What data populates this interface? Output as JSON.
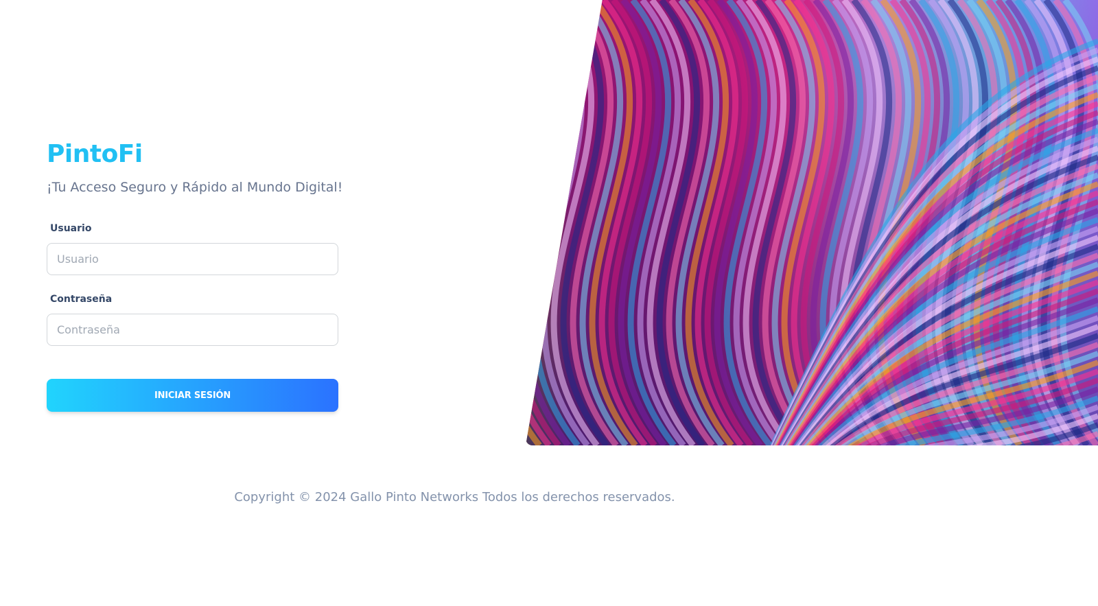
{
  "brand": {
    "name": "PintoFi",
    "tagline": "¡Tu Acceso Seguro y Rápido al Mundo Digital!"
  },
  "login_form": {
    "username": {
      "label": "Usuario",
      "placeholder": "Usuario",
      "value": ""
    },
    "password": {
      "label": "Contraseña",
      "placeholder": "Contraseña",
      "value": ""
    },
    "submit_label": "INICIAR SESIÓN"
  },
  "footer": {
    "copyright": "Copyright © 2024 Gallo Pinto Networks Todos los derechos reservados."
  },
  "colors": {
    "brand": "#21c0f3",
    "button_start": "#21d4fd",
    "button_end": "#2b72ff",
    "label": "#344767",
    "muted_text": "#67748e"
  }
}
